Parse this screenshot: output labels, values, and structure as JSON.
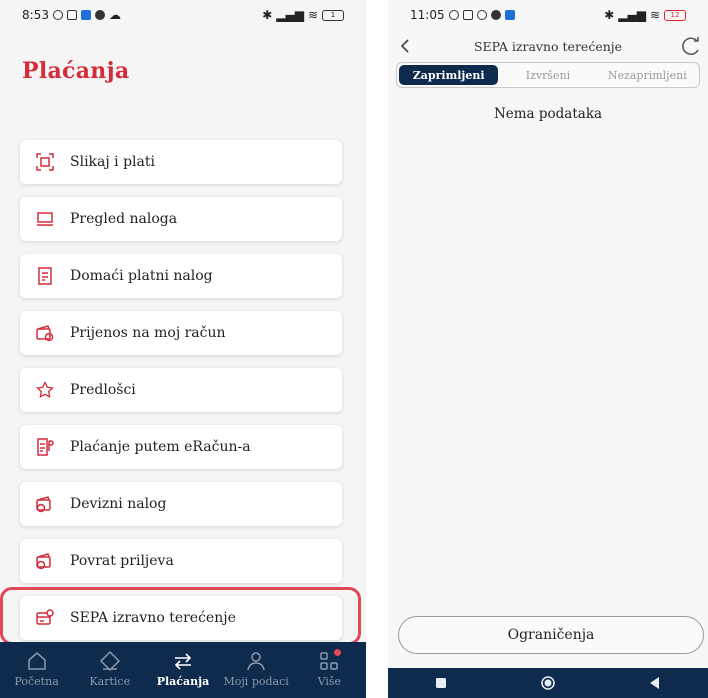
{
  "left": {
    "status": {
      "time": "8:53",
      "battery": "1"
    },
    "title": "Plaćanja",
    "menu": [
      {
        "label": "Slikaj i plati",
        "icon": "qr-scan-icon"
      },
      {
        "label": "Pregled naloga",
        "icon": "inbox-icon"
      },
      {
        "label": "Domaći platni nalog",
        "icon": "document-icon"
      },
      {
        "label": "Prijenos na moj račun",
        "icon": "wallet-transfer-icon"
      },
      {
        "label": "Predlošci",
        "icon": "star-icon"
      },
      {
        "label": "Plaćanje putem eRačun-a",
        "icon": "einvoice-icon"
      },
      {
        "label": "Devizni nalog",
        "icon": "currency-wallet-icon"
      },
      {
        "label": "Povrat priljeva",
        "icon": "return-wallet-icon"
      },
      {
        "label": "SEPA izravno terećenje",
        "icon": "sepa-card-icon"
      }
    ],
    "nav": [
      {
        "label": "Početna",
        "icon": "home-icon"
      },
      {
        "label": "Kartice",
        "icon": "card-icon"
      },
      {
        "label": "Plaćanja",
        "icon": "transfer-icon"
      },
      {
        "label": "Moji podaci",
        "icon": "user-icon"
      },
      {
        "label": "Više",
        "icon": "grid-icon"
      }
    ],
    "accent": "#d62b3a",
    "nav_bg": "#0e2a4c"
  },
  "right": {
    "status": {
      "time": "11:05",
      "battery": "12"
    },
    "header_title": "SEPA izravno terećenje",
    "tabs": [
      "Zaprimljeni",
      "Izvršeni",
      "Nezaprimljeni"
    ],
    "empty_message": "Nema podataka",
    "limits_button": "Ograničenja"
  }
}
